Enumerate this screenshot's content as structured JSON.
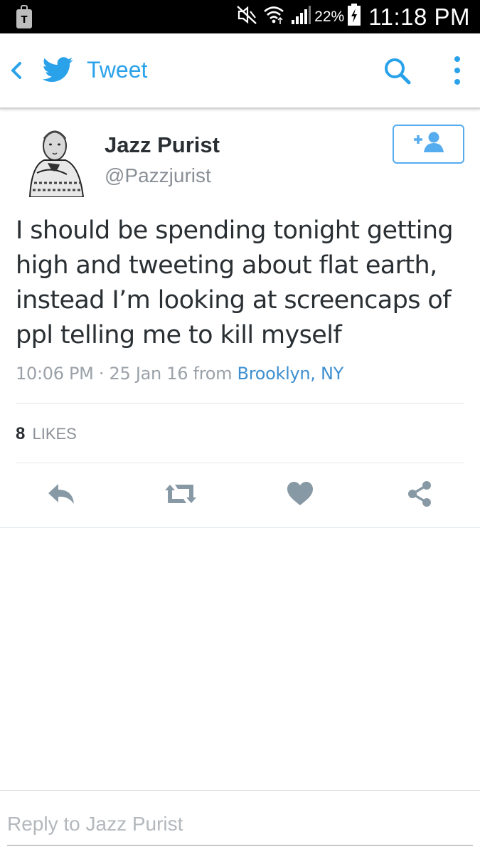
{
  "status_bar": {
    "battery_pct": "22%",
    "time": "11:18 PM",
    "icons": [
      "carrier-tmobile-icon",
      "mute-icon",
      "wifi-icon",
      "signal-icon",
      "battery-charging-icon"
    ]
  },
  "app_bar": {
    "title": "Tweet",
    "icons": [
      "back-chevron-icon",
      "twitter-bird-icon",
      "search-icon",
      "overflow-menu-icon"
    ],
    "accent_color": "#2aa2ea"
  },
  "tweet": {
    "author_name": "Jazz Purist",
    "author_handle": "@Pazzjurist",
    "text": "I should be spending tonight getting high and tweeting about flat earth, instead I’m looking at screencaps of ppl telling me to kill myself",
    "timestamp": "10:06 PM · 25 Jan 16",
    "from_label": "from",
    "location": "Brooklyn, NY",
    "likes_count": "8",
    "likes_label": "LIKES",
    "follow_icon": "add-user-icon"
  },
  "actions": [
    "reply-icon",
    "retweet-icon",
    "like-heart-icon",
    "share-icon"
  ],
  "reply": {
    "placeholder": "Reply to Jazz Purist"
  }
}
